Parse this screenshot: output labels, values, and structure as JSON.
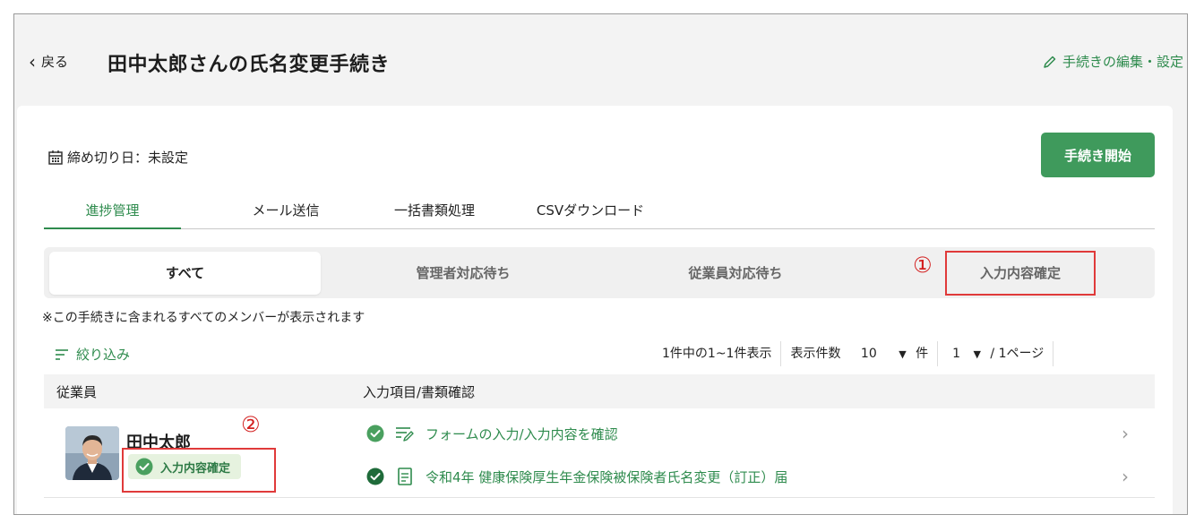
{
  "header": {
    "back_label": "戻る",
    "title": "田中太郎さんの氏名変更手続き",
    "edit_label": "手続きの編集・設定"
  },
  "deadline": {
    "label": "締め切り日：未設定"
  },
  "start_button": "手続き開始",
  "tabs": [
    "進捗管理",
    "メール送信",
    "一括書類処理",
    "CSVダウンロード"
  ],
  "filter_tabs": [
    "すべて",
    "管理者対応待ち",
    "従業員対応待ち",
    "入力内容確定"
  ],
  "annotations": {
    "one": "①",
    "two": "②"
  },
  "note": "※この手続きに含まれるすべてのメンバーが表示されます",
  "refine_label": "絞り込み",
  "pager": {
    "summary": "1件中の1~1件表示",
    "per_page_label": "表示件数",
    "per_page_value": "10",
    "per_page_unit": "件",
    "page_value": "1",
    "page_total": "/ 1ページ"
  },
  "table": {
    "col_employee": "従業員",
    "col_items": "入力項目/書類確認"
  },
  "row": {
    "name": "田中太郎",
    "status": "入力内容確定",
    "items": [
      "フォームの入力/入力内容を確認",
      "令和4年 健康保険厚生年金保険被保険者氏名変更（訂正）届"
    ]
  },
  "colors": {
    "accent": "#2e8b4d",
    "button": "#3f9a5c",
    "badge_bg": "#e6f2df",
    "annotation": "#e03a3a"
  }
}
